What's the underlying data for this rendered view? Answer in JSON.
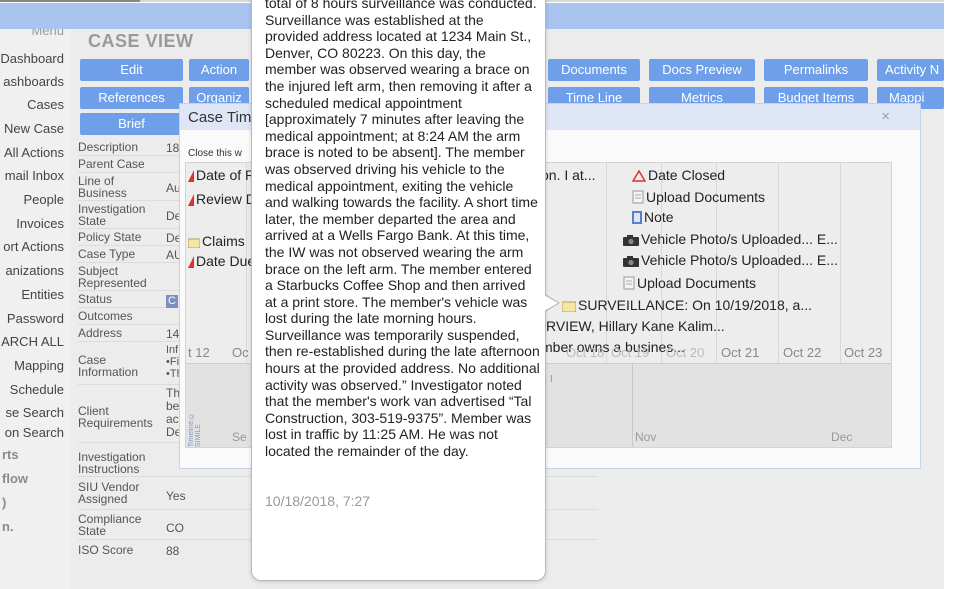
{
  "sidebar": {
    "items": [
      {
        "label": "Menu",
        "kind": "menu"
      },
      {
        "label": "Dashboard"
      },
      {
        "label": "ashboards"
      },
      {
        "label": "Cases"
      },
      {
        "label": "New Case"
      },
      {
        "label": "All Actions"
      },
      {
        "label": "mail Inbox"
      },
      {
        "label": "People"
      },
      {
        "label": "Invoices"
      },
      {
        "label": "ort Actions"
      },
      {
        "label": "anizations"
      },
      {
        "label": "Entities"
      },
      {
        "label": "Password"
      },
      {
        "label": "ARCH ALL"
      },
      {
        "label": "Mapping"
      },
      {
        "label": "Schedule"
      },
      {
        "label": "se Search"
      },
      {
        "label": "on Search"
      },
      {
        "label": "rts",
        "kind": "head"
      },
      {
        "label": "flow",
        "kind": "head"
      },
      {
        "label": ")",
        "kind": "head"
      },
      {
        "label": "n.",
        "kind": "head"
      }
    ]
  },
  "main": {
    "title": "CASE VIEW",
    "nav_row1": [
      "Edit",
      "Action",
      "Documents",
      "Docs Preview",
      "Permalinks",
      "Activity N"
    ],
    "nav_row2": [
      "References",
      "Organiz",
      "Time Line",
      "Metrics",
      "Budget Items",
      "Mappi"
    ],
    "nav_row3": [
      "Brief"
    ]
  },
  "fields": [
    {
      "label": "Description",
      "value": "18"
    },
    {
      "label": "Parent Case",
      "value": ""
    },
    {
      "label": "Line of Business",
      "value": "Au"
    },
    {
      "label": "Investigation State",
      "value": "De"
    },
    {
      "label": "Policy State",
      "value": "De"
    },
    {
      "label": "Case Type",
      "value": "AU"
    },
    {
      "label": "Subject Represented",
      "value": ""
    },
    {
      "label": "Status",
      "value": "C"
    },
    {
      "label": "Outcomes",
      "value": ""
    },
    {
      "label": "Address",
      "value": "14"
    },
    {
      "label": "Case Information",
      "value": "Inf\n•Fi\n•Th"
    },
    {
      "label": "Client Requirements",
      "value": "Th\nbe\nac\nDetection Age"
    },
    {
      "label": "Investigation Instructions",
      "value": ""
    },
    {
      "label": "SIU Vendor Assigned",
      "value": "Yes"
    },
    {
      "label": "Compliance State",
      "value": "CO"
    },
    {
      "label": "ISO Score",
      "value": "88"
    }
  ],
  "dialog": {
    "title": "Case Tim",
    "close_link": "Close this w",
    "close_icon": "×"
  },
  "timeline": {
    "events": [
      {
        "icon": "warning-icon",
        "text": "Date of R"
      },
      {
        "icon": "warning-icon",
        "text": "Review D"
      },
      {
        "icon": "note-icon",
        "text": "Claims"
      },
      {
        "icon": "warning-icon",
        "text": "Date Due"
      },
      {
        "icon": "none",
        "text": "on. I at..."
      },
      {
        "icon": "warning-icon",
        "text": "Date Closed"
      },
      {
        "icon": "document-icon",
        "text": "Upload Documents"
      },
      {
        "icon": "note-icon",
        "text": "Note"
      },
      {
        "icon": "camera-icon",
        "text": "Vehicle Photo/s Uploaded... E..."
      },
      {
        "icon": "camera-icon",
        "text": "Vehicle Photo/s Uploaded... E..."
      },
      {
        "icon": "document-icon",
        "text": "Upload Documents"
      },
      {
        "icon": "note-icon",
        "text": "SURVEILLANCE: On 10/19/2018, a..."
      },
      {
        "icon": "none",
        "text": "RVIEW, Hillary Kane Kalim..."
      },
      {
        "icon": "none",
        "text": "mber owns a busines..."
      }
    ],
    "ticks": [
      "t 12",
      "Oc",
      "Oct 18",
      "Oct 19",
      "Oct 20",
      "Oct 21",
      "Oct 22",
      "Oct 23"
    ],
    "months": [
      "Se",
      "Nov",
      "Dec"
    ],
    "credit": "Timeline © SIMILE",
    "band_mark": "I"
  },
  "bubble": {
    "text": "total of 8 hours surveillance was conducted. Surveillance was established at the provided address located at 1234 Main St., Denver, CO 80223. On this day, the member was observed wearing a brace on the injured left arm, then removing it after a scheduled medical appointment [approximately 7 minutes after leaving the medical appointment; at 8:24 AM the arm brace is noted to be absent]. The member was observed driving his vehicle to the medical appointment, exiting the vehicle and walking towards the facility. A short time later, the member departed the area and arrived at a Wells Fargo Bank. At this time, the IW was not observed wearing the arm brace on the left arm. The member entered a Starbucks Coffee Shop and then arrived at a print store. The member's vehicle was lost during the late morning hours. Surveillance was temporarily suspended, then re-established during the late afternoon hours at the provided address. No additional activity was observed.” Investigator noted that the member's work van advertised “Tal Construction, 303-519-9375”. Member was lost in traffic by 11:25 AM. He was not located the remainder of the day.",
    "date": "10/18/2018, 7:27"
  },
  "colors": {
    "accent": "#6f9fe8",
    "topbar": "#aac4f0",
    "warning": "#e03030",
    "status_chip": "#7d8fbf"
  }
}
